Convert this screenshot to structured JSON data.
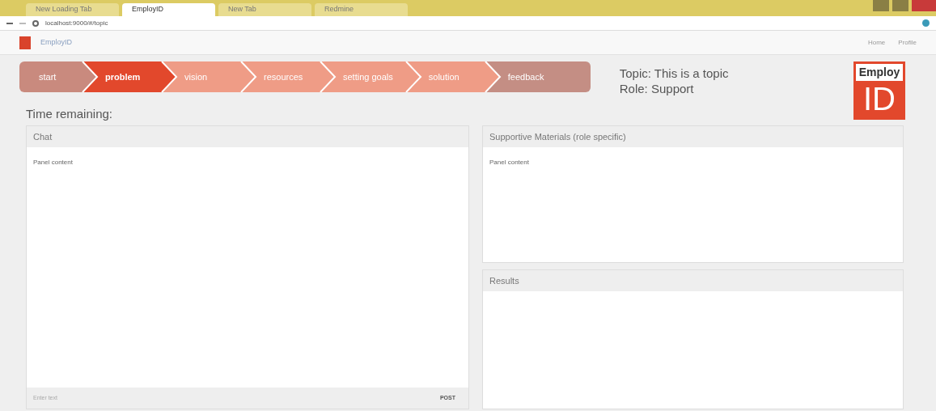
{
  "browser": {
    "tabs": [
      {
        "title": "New Loading Tab",
        "selected": false
      },
      {
        "title": "EmployID",
        "selected": true
      },
      {
        "title": "New Tab",
        "selected": false
      },
      {
        "title": "Redmine",
        "selected": false
      }
    ],
    "address": "localhost:9000/#/topic"
  },
  "header": {
    "brand": "EmployID",
    "nav": [
      "Home",
      "Profile"
    ]
  },
  "steps": [
    {
      "label": "start",
      "selected": false,
      "color": "#c98a7e"
    },
    {
      "label": "problem",
      "selected": true,
      "color": "#e2482c"
    },
    {
      "label": "vision",
      "selected": false,
      "color": "#ef9c86"
    },
    {
      "label": "resources",
      "selected": false,
      "color": "#ef9c86"
    },
    {
      "label": "setting goals",
      "selected": false,
      "color": "#ef9c86"
    },
    {
      "label": "solution",
      "selected": false,
      "color": "#ef9c86"
    },
    {
      "label": "feedback",
      "selected": false,
      "color": "#c48e84"
    }
  ],
  "topic": "Topic: This is a topic",
  "role": "Role: Support",
  "logo": {
    "top": "Employ",
    "bottom": "ID"
  },
  "time_remaining": "Time remaining:",
  "chat": {
    "title": "Chat",
    "content": "Panel content",
    "input": {
      "placeholder": "Enter text"
    },
    "button": "POST"
  },
  "materials": {
    "title": "Supportive Materials (role specific)",
    "content": "Panel content"
  },
  "results": {
    "title": "Results"
  }
}
